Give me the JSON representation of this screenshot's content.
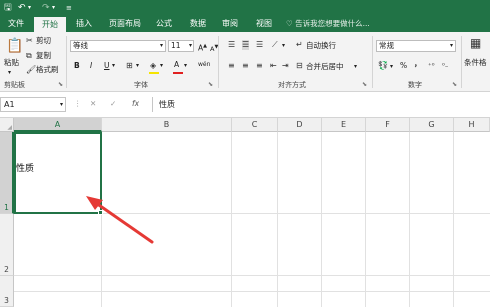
{
  "quick_access": {
    "save_icon": "save-icon",
    "undo_icon": "undo-icon",
    "redo_icon": "redo-icon",
    "customize_icon": "customize-icon"
  },
  "tabs": [
    {
      "label": "文件"
    },
    {
      "label": "开始"
    },
    {
      "label": "插入"
    },
    {
      "label": "页面布局"
    },
    {
      "label": "公式"
    },
    {
      "label": "数据"
    },
    {
      "label": "审阅"
    },
    {
      "label": "视图"
    }
  ],
  "tell_me": "告诉我您想要做什么...",
  "ribbon": {
    "clipboard": {
      "paste": "粘贴",
      "cut": "剪切",
      "copy": "复制",
      "format_painter": "格式刷",
      "label": "剪贴板"
    },
    "font": {
      "name": "等线",
      "size": "11",
      "grow": "A",
      "shrink": "A",
      "bold": "B",
      "italic": "I",
      "underline": "U",
      "wen": "wén",
      "font_color": "A",
      "label": "字体"
    },
    "alignment": {
      "wrap": "自动换行",
      "merge": "合并后居中",
      "label": "对齐方式"
    },
    "number": {
      "format": "常规",
      "percent": "%",
      "comma": "，",
      "label": "数字"
    },
    "styles": {
      "conditional": "条件格"
    }
  },
  "formula_bar": {
    "name_box": "A1",
    "cancel": "✕",
    "enter": "✓",
    "fx": "fx",
    "content": "性质"
  },
  "sheet": {
    "columns": [
      "A",
      "B",
      "C",
      "D",
      "E",
      "F",
      "G",
      "H"
    ],
    "rows": [
      "1",
      "2",
      "3"
    ],
    "selected_cell_text": "性质"
  },
  "colors": {
    "accent": "#217346",
    "arrow": "#e53935"
  }
}
